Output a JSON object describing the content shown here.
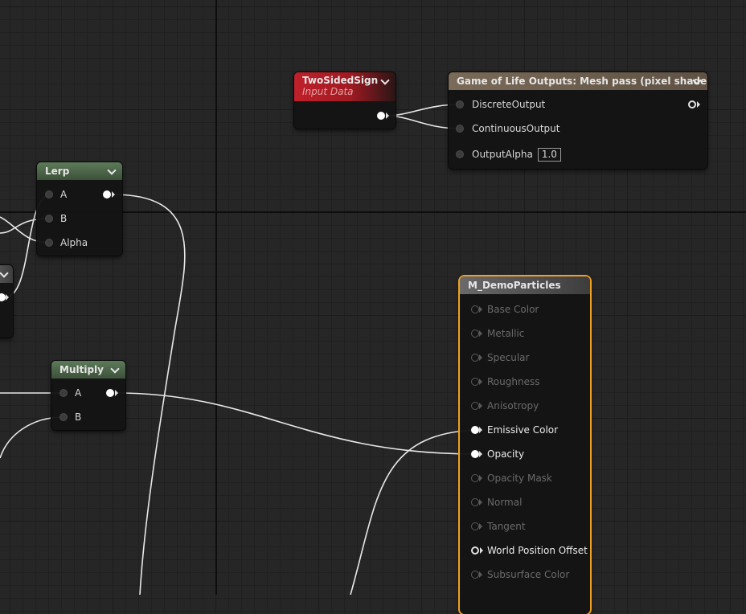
{
  "nodes": {
    "two_sided_sign": {
      "title": "TwoSidedSign",
      "subtitle": "Input Data"
    },
    "gol_outputs": {
      "title": "Game of Life Outputs: Mesh pass (pixel shader)",
      "pins": [
        "DiscreteOutput",
        "ContinuousOutput",
        "OutputAlpha"
      ],
      "output_alpha_value": "1.0"
    },
    "lerp": {
      "title": "Lerp",
      "pins": [
        "A",
        "B",
        "Alpha"
      ]
    },
    "multiply": {
      "title": "Multiply",
      "pins": [
        "A",
        "B"
      ]
    },
    "material": {
      "title": "M_DemoParticles",
      "pins": [
        "Base Color",
        "Metallic",
        "Specular",
        "Roughness",
        "Anisotropy",
        "Emissive Color",
        "Opacity",
        "Opacity Mask",
        "Normal",
        "Tangent",
        "World Position Offset",
        "Subsurface Color"
      ]
    }
  },
  "colors": {
    "lerp_header": "#4f6a4b",
    "multiply_header": "#4f6a4b",
    "two_sided_sign_header": "#c0202a",
    "gol_outputs_header": "#7a6a58",
    "material_selection": "#f0a020"
  }
}
